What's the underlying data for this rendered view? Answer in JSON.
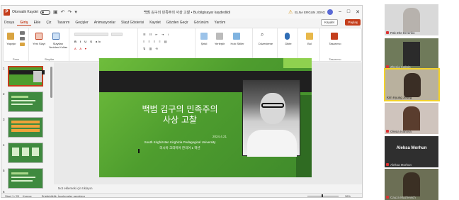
{
  "titlebar": {
    "autosave_label": "Otomatik Kaydet",
    "document_title": "백범 김구의 민족주의 사상 고찰 • Bu bilgisayar kaydedildi",
    "user": "ELNA ERGUN JONG",
    "warning_symbol": "⚠"
  },
  "tabs": [
    "Dosya",
    "Giriş",
    "Ekle",
    "Çiz",
    "Tasarım",
    "Geçişler",
    "Animasyonlar",
    "Slayt Gösterisi",
    "Kaydet",
    "Gözden Geçir",
    "Görünüm",
    "Yardım"
  ],
  "active_tab": "Giriş",
  "buttons": {
    "kaydet": "Kaydet",
    "paylas": "Paylaş"
  },
  "ribbon": {
    "groups": [
      "Pano",
      "Slaytlar",
      "Yazı Tipi",
      "Paragraf",
      "Çizim",
      "Düzenleme",
      "Ses",
      "Tasarımcı"
    ],
    "items": {
      "yapistir": "Yapıştır",
      "yeni_slayt": "Yeni Slayt",
      "slaytlari_yeniden": "Slaytları Yeniden Kullan",
      "sekil": "Şekil",
      "yerlestir": "Yerleştir",
      "hizli": "Hızlı Stiller",
      "duzenleme": "Düzenleme",
      "dikte": "Dikte",
      "bul": "Bul",
      "tasarimci": "Tasarımcı"
    }
  },
  "slides": {
    "count": 6,
    "selected": 1,
    "numbers": [
      "1",
      "2",
      "3",
      "4",
      "5",
      "6"
    ]
  },
  "slide": {
    "title_line1": "백범 김구의 민족주의",
    "title_line2": "사상 고찰",
    "date": "2024.4.21",
    "university": "South Kirghizstan Kirghizia Pedagogical University",
    "author": "러시아 크리미아 한국어 1 학년"
  },
  "notes_placeholder": "Not eklemek için tıklayın",
  "status": {
    "slide_count": "Slayt 1 / 20",
    "language": "Korece",
    "accessibility": "Erişilebilirlik: İncelemeler gerekiyor",
    "zoom": "36%"
  },
  "participants": [
    {
      "name": "Pak Zhe Ervenko",
      "mic_off": true
    },
    {
      "name": "Zhenja Kalinin",
      "mic_off": true
    },
    {
      "name": "Kim Kyung Jeong",
      "mic_off": false
    },
    {
      "name": "Olesia Ivanova",
      "mic_off": true
    },
    {
      "name": "Aleksa Morhun",
      "mic_off": true
    },
    {
      "name": "Cauza Mazhevich",
      "mic_off": true
    }
  ],
  "participant_big_name": "Aleksa Morhun",
  "colors": {
    "accent": "#c43e1c",
    "slide_green": "#4e9d2e",
    "active_speaker": "#f2d22c"
  }
}
